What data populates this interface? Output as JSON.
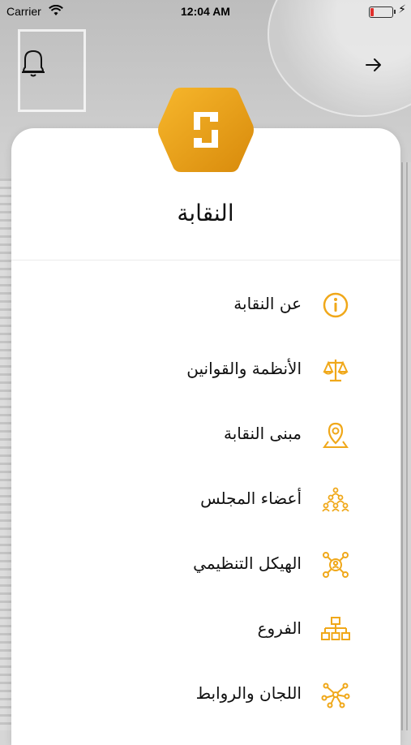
{
  "status": {
    "carrier": "Carrier",
    "time": "12:04 AM"
  },
  "header": {
    "title": "النقابة",
    "icons": {
      "left": "bell-icon",
      "right": "arrow-right-icon"
    }
  },
  "colors": {
    "accent": "#F0A81A",
    "text": "#111111"
  },
  "menu": {
    "items": [
      {
        "label": "عن النقابة",
        "icon": "info-icon"
      },
      {
        "label": "الأنظمة والقوانين",
        "icon": "scales-icon"
      },
      {
        "label": "مبنى النقابة",
        "icon": "location-pin-icon"
      },
      {
        "label": "أعضاء المجلس",
        "icon": "people-group-icon"
      },
      {
        "label": "الهيكل التنظيمي",
        "icon": "org-network-icon"
      },
      {
        "label": "الفروع",
        "icon": "hierarchy-icon"
      },
      {
        "label": "اللجان والروابط",
        "icon": "share-nodes-icon"
      }
    ]
  }
}
